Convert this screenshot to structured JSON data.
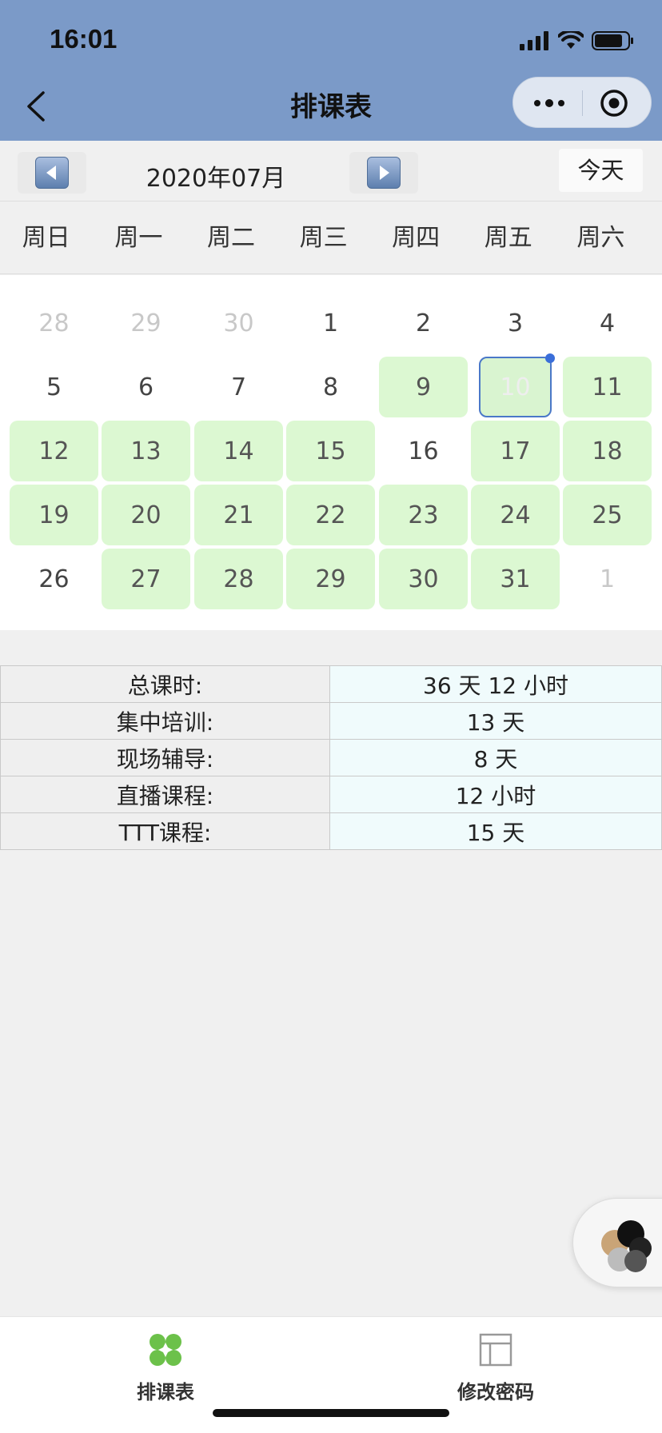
{
  "status": {
    "time": "16:01"
  },
  "nav": {
    "title": "排课表"
  },
  "toolbar": {
    "month": "2020年07月",
    "today": "今天"
  },
  "weekdays": [
    "周日",
    "周一",
    "周二",
    "周三",
    "周四",
    "周五",
    "周六"
  ],
  "calendar": {
    "rows": [
      [
        {
          "d": "28",
          "s": "muted"
        },
        {
          "d": "29",
          "s": "muted"
        },
        {
          "d": "30",
          "s": "muted"
        },
        {
          "d": "1",
          "s": ""
        },
        {
          "d": "2",
          "s": ""
        },
        {
          "d": "3",
          "s": ""
        },
        {
          "d": "4",
          "s": ""
        }
      ],
      [
        {
          "d": "5",
          "s": ""
        },
        {
          "d": "6",
          "s": ""
        },
        {
          "d": "7",
          "s": ""
        },
        {
          "d": "8",
          "s": ""
        },
        {
          "d": "9",
          "s": "course"
        },
        {
          "d": "10",
          "s": "selected"
        },
        {
          "d": "11",
          "s": "course"
        }
      ],
      [
        {
          "d": "12",
          "s": "course"
        },
        {
          "d": "13",
          "s": "course"
        },
        {
          "d": "14",
          "s": "course"
        },
        {
          "d": "15",
          "s": "course"
        },
        {
          "d": "16",
          "s": ""
        },
        {
          "d": "17",
          "s": "course"
        },
        {
          "d": "18",
          "s": "course"
        }
      ],
      [
        {
          "d": "19",
          "s": "course"
        },
        {
          "d": "20",
          "s": "course"
        },
        {
          "d": "21",
          "s": "course"
        },
        {
          "d": "22",
          "s": "course"
        },
        {
          "d": "23",
          "s": "course"
        },
        {
          "d": "24",
          "s": "course"
        },
        {
          "d": "25",
          "s": "course"
        }
      ],
      [
        {
          "d": "26",
          "s": ""
        },
        {
          "d": "27",
          "s": "course"
        },
        {
          "d": "28",
          "s": "course"
        },
        {
          "d": "29",
          "s": "course"
        },
        {
          "d": "30",
          "s": "course"
        },
        {
          "d": "31",
          "s": "course"
        },
        {
          "d": "1",
          "s": "muted"
        }
      ]
    ]
  },
  "summary": [
    {
      "label": "总课时:",
      "value": "36 天 12 小时"
    },
    {
      "label": "集中培训:",
      "value": "13 天"
    },
    {
      "label": "现场辅导:",
      "value": "8 天"
    },
    {
      "label": "直播课程:",
      "value": "12 小时"
    },
    {
      "label": "TTT课程:",
      "value": "15 天"
    }
  ],
  "tabbar": {
    "schedule": "排课表",
    "password": "修改密码"
  },
  "colors": {
    "header": "#7b9ac8",
    "course_day": "#dcf8d2",
    "selected_border": "#4a78c8",
    "summary_value_bg": "#f0fbfc"
  }
}
